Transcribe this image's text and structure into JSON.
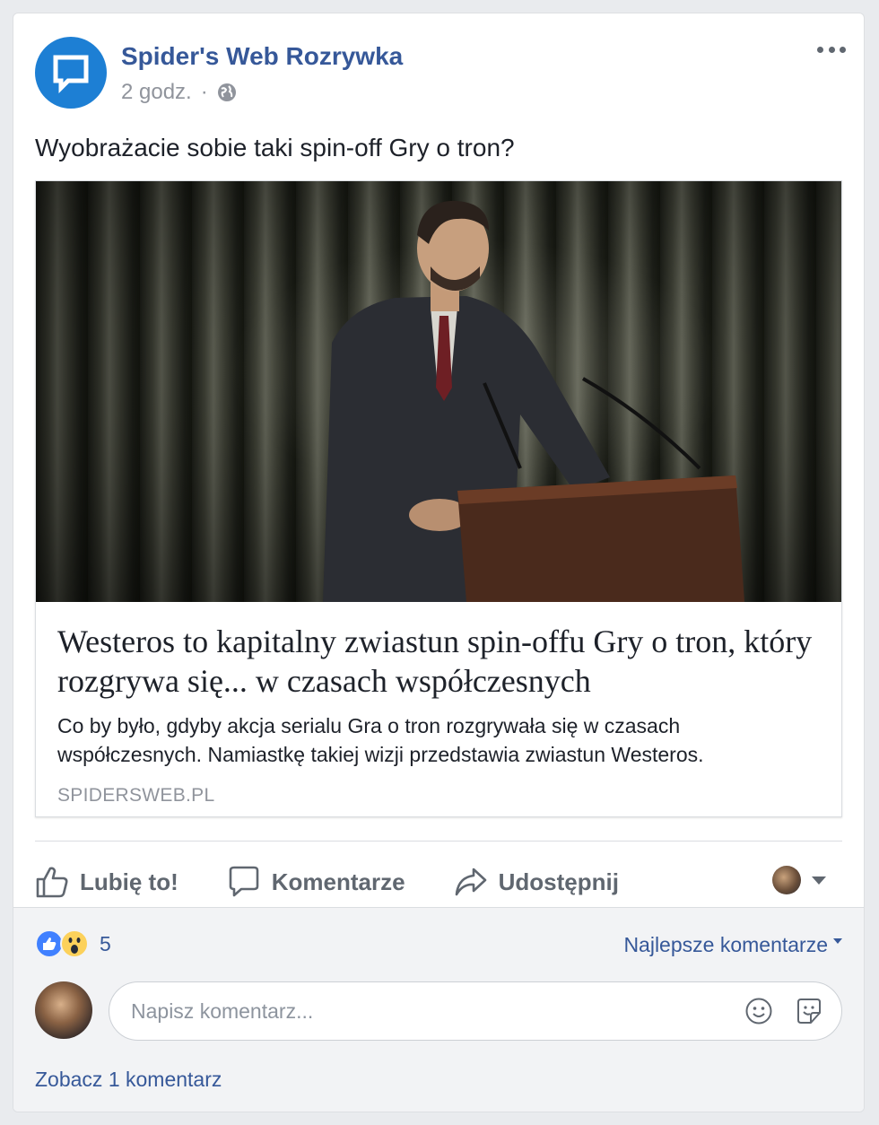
{
  "post": {
    "page_name": "Spider's Web Rozrywka",
    "time": "2 godz.",
    "separator": "·",
    "text": "Wyobrażacie sobie taki spin-off Gry o tron?"
  },
  "link_preview": {
    "title": "Westeros to kapitalny zwiastun spin-offu Gry o tron, który rozgrywa się... w czasach współczesnych",
    "description": "Co by było, gdyby akcja serialu Gra o tron rozgrywała się w czasach współczesnych. Namiastkę takiej wizji przedstawia zwiastun Westeros.",
    "domain": "SPIDERSWEB.PL"
  },
  "actions": {
    "like": "Lubię to!",
    "comment": "Komentarze",
    "share": "Udostępnij"
  },
  "reactions": {
    "count": "5",
    "best_comments": "Najlepsze komentarze"
  },
  "comment_box": {
    "placeholder": "Napisz komentarz..."
  },
  "see_comments": "Zobacz 1 komentarz",
  "colors": {
    "link_blue": "#365899",
    "page_avatar": "#1d7fd4",
    "like_reaction": "#4080ff",
    "wow_reaction": "#fcd15b"
  }
}
